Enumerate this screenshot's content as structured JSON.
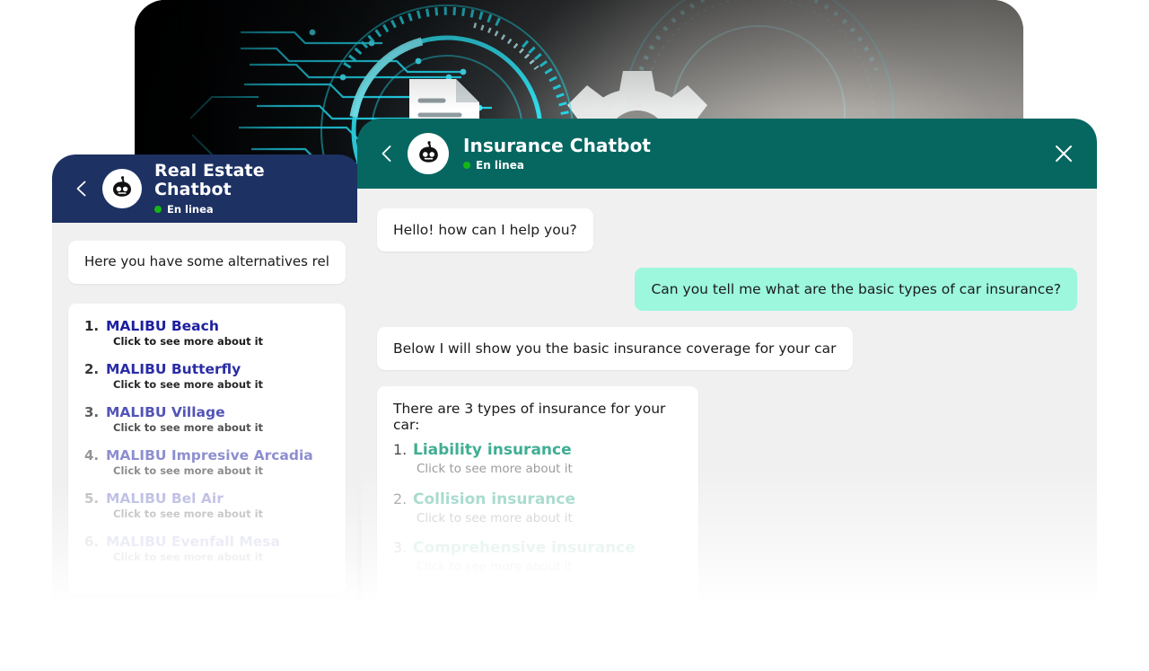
{
  "background": {
    "name": "insurtech-hero-image",
    "description": "dark tech background with cyan circuit traces, HUD rings, document-check icon and gear",
    "accent_cyan": "#25e0f0",
    "dark": "#05070a",
    "light": "#a6a29c"
  },
  "colors": {
    "real_estate_header": "#1d3163",
    "insurance_header": "#066761",
    "user_bubble": "#9cf7dd",
    "bot_bubble": "#ffffff",
    "chat_bg": "#f0f0f0",
    "online_dot": "#16b616",
    "real_estate_link": "#1d1fa0",
    "insurance_link": "#3fae93"
  },
  "panels": {
    "real_estate": {
      "header": {
        "title": "Real Estate Chatbot",
        "status": "En linea",
        "back_icon": "chevron-left-icon",
        "avatar_icon": "robot-avatar-icon"
      },
      "messages": [
        {
          "from": "bot",
          "text": "Here you have some alternatives rel"
        }
      ],
      "options": [
        {
          "num": "1.",
          "title": "MALIBU Beach",
          "sub": "Click to see more about it",
          "opacity": 1.0
        },
        {
          "num": "2.",
          "title": "MALIBU Butterfly",
          "sub": "Click to see more about it",
          "opacity": 0.94
        },
        {
          "num": "3.",
          "title": "MALIBU Village",
          "sub": "Click to see more about it",
          "opacity": 0.76
        },
        {
          "num": "4.",
          "title": "MALIBU Impresive Arcadia",
          "sub": "Click to see more about it",
          "opacity": 0.5
        },
        {
          "num": "5.",
          "title": "MALIBU Bel Air",
          "sub": "Click to see more about it",
          "opacity": 0.3
        },
        {
          "num": "6.",
          "title": "MALIBU Evenfall Mesa",
          "sub": "Click to see more about it",
          "opacity": 0.14
        }
      ]
    },
    "insurance": {
      "header": {
        "title": "Insurance Chatbot",
        "status": "En linea",
        "back_icon": "chevron-left-icon",
        "avatar_icon": "robot-avatar-icon",
        "close_icon": "close-x-icon"
      },
      "messages": [
        {
          "from": "bot",
          "text": "Hello! how can I help you?"
        },
        {
          "from": "user",
          "text": "Can you tell me what are the basic types of car insurance?"
        },
        {
          "from": "bot",
          "text": "Below I will show you the basic insurance coverage for your car"
        }
      ],
      "list_intro": "There are 3 types of insurance for your car:",
      "options": [
        {
          "num": "1.",
          "title": "Liability insurance",
          "sub": "Click to see more about it",
          "opacity": 1.0
        },
        {
          "num": "2.",
          "title": "Collision insurance",
          "sub": "Click to see more about it",
          "opacity": 0.55
        },
        {
          "num": "3.",
          "title": "Comprehensive insurance",
          "sub": "Click to see more about it",
          "opacity": 0.22
        }
      ]
    }
  }
}
